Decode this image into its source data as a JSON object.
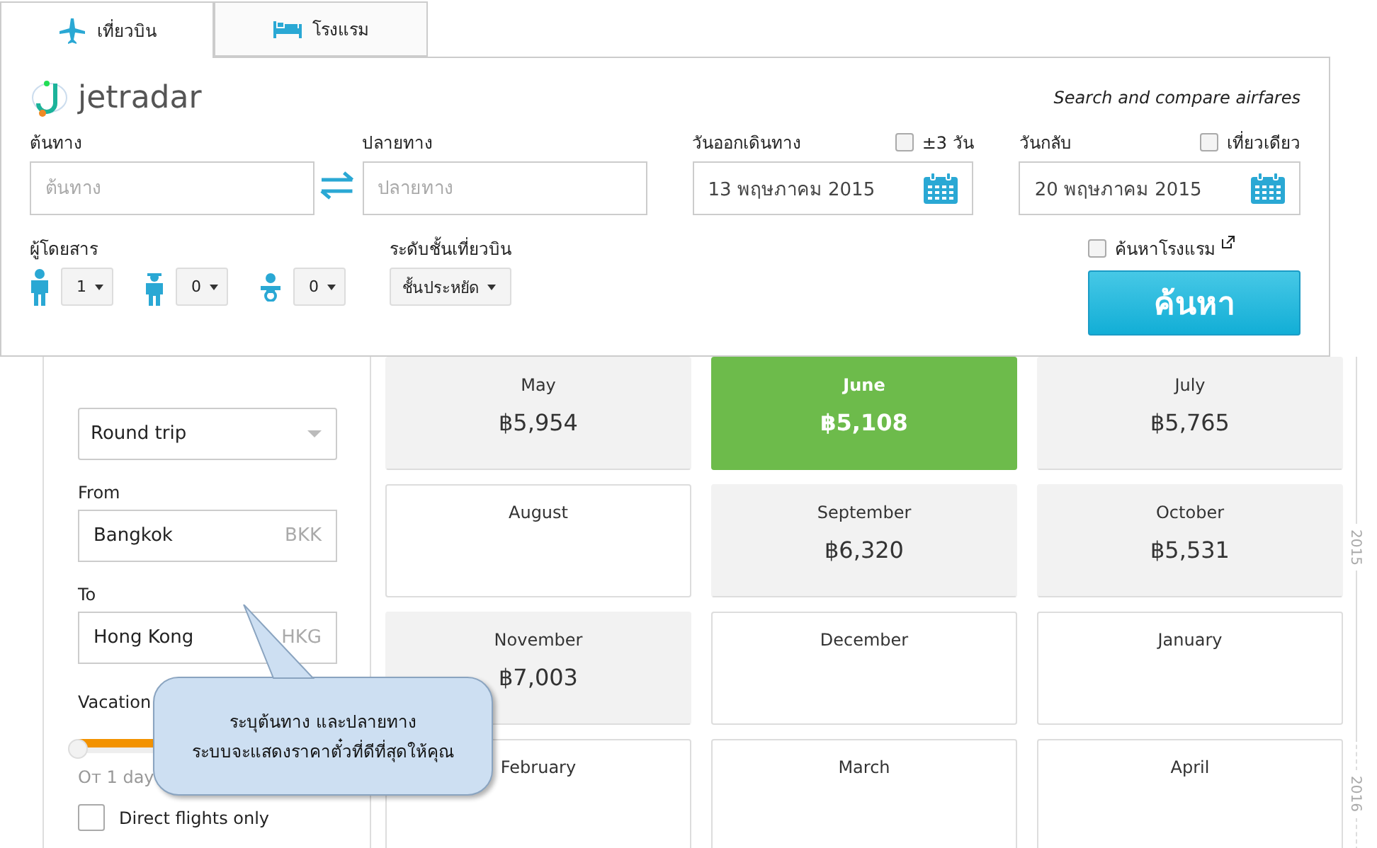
{
  "tabs": [
    {
      "label": "เที่ยวบิน",
      "kind": "flight",
      "selected": true
    },
    {
      "label": "โรงแรม",
      "kind": "hotel",
      "selected": false
    }
  ],
  "search_panel": {
    "logo": "jetradar",
    "tagline": "Search and compare airfares",
    "origin": {
      "label": "ต้นทาง",
      "placeholder": "ต้นทาง"
    },
    "destination": {
      "label": "ปลายทาง",
      "placeholder": "ปลายทาง"
    },
    "depart": {
      "label": "วันออกเดินทาง",
      "value": "13 พฤษภาคม 2015",
      "option": {
        "label": "±3 วัน",
        "checked": false
      }
    },
    "return": {
      "label": "วันกลับ",
      "value": "20 พฤษภาคม 2015",
      "option": {
        "label": "เที่ยวเดียว",
        "checked": false
      }
    },
    "passengers": {
      "label": "ผู้โดยสาร",
      "items": [
        {
          "kind": "adult",
          "value": "1"
        },
        {
          "kind": "child",
          "value": "0"
        },
        {
          "kind": "infant",
          "value": "0"
        }
      ]
    },
    "cabin": {
      "label": "ระดับชั้นเที่ยวบิน",
      "value": "ชั้นประหยัด"
    },
    "hotel_search": {
      "label": "ค้นหาโรงแรม",
      "checked": false
    },
    "search_button": "ค้นหา"
  },
  "sidebar": {
    "trip_type": "Round trip",
    "from": {
      "label": "From",
      "value": "Bangkok",
      "code": "BKK"
    },
    "to": {
      "label": "To",
      "value": "Hong Kong",
      "code": "HKG"
    },
    "duration": {
      "label": "Vacation",
      "level": 1,
      "min_label": "От 1 day"
    },
    "direct": {
      "label": "Direct flights only",
      "checked": false
    }
  },
  "months": [
    {
      "name": "May",
      "price": "฿5,954",
      "selected": false
    },
    {
      "name": "June",
      "price": "฿5,108",
      "selected": true
    },
    {
      "name": "July",
      "price": "฿5,765",
      "selected": false
    },
    {
      "name": "August",
      "selected": false
    },
    {
      "name": "September",
      "price": "฿6,320",
      "selected": false
    },
    {
      "name": "October",
      "price": "฿5,531",
      "selected": false
    },
    {
      "name": "November",
      "price": "฿7,003",
      "selected": false
    },
    {
      "name": "December",
      "selected": false
    },
    {
      "name": "January",
      "selected": false
    },
    {
      "name": "February",
      "selected": false
    },
    {
      "name": "March",
      "selected": false
    },
    {
      "name": "April",
      "selected": false
    }
  ],
  "timeline": [
    "2015",
    "2016"
  ],
  "callout": [
    "ระบุต้นทาง และปลายทาง",
    "ระบบจะแสดงราคาตั๋วที่ดีที่สุดให้คุณ"
  ]
}
